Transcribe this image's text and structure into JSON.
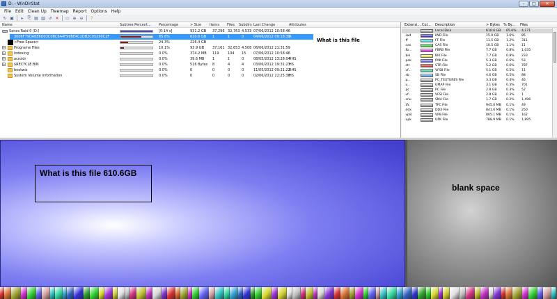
{
  "window": {
    "title": "D: - WinDirStat",
    "min_label": "–",
    "max_label": "□",
    "close_label": "✕"
  },
  "menu": [
    "File",
    "Edit",
    "Clean Up",
    "Treemap",
    "Report",
    "Options",
    "Help"
  ],
  "toolbar_icons": [
    "refresh-icon",
    "select-icon",
    "stop-icon",
    "copy-icon",
    "open-icon",
    "properties-icon",
    "cleanup-icon",
    "delete-icon",
    "new-folder-icon",
    "zoom-in-icon",
    "zoom-out-icon",
    "help-icon"
  ],
  "dir_columns": [
    "Name",
    "Subtree Percent...",
    "Percentage",
    "> Size",
    "Items",
    "Files",
    "Subdirs",
    "Last Change",
    "Attributes"
  ],
  "dir_rows": [
    {
      "expander": "",
      "icon": "drive",
      "name": "Sanes Raid 0 (D:)",
      "bar_pct": 1.0,
      "bar_color": "#4a4aa8",
      "pct": "[0:14 s]",
      "size": "931.2 GB",
      "items": "37,296",
      "files": "32,763",
      "subdirs": "4,533",
      "last_change": "07/06/2012 10:58:46",
      "attr": ""
    },
    {
      "expander": "",
      "icon": "none",
      "name": "3008F79DA6E6D03C0BC6A4F99BE4C2DB2C05290C2F",
      "bar_pct": 0.656,
      "bar_color": "#7a1f1f",
      "pct": "65.6%",
      "size": "610.6 GB",
      "items": "1",
      "files": "1",
      "subdirs": "0",
      "last_change": "04/06/2012 09:18:39",
      "attr": "A",
      "selected": true
    },
    {
      "expander": "",
      "icon": "black",
      "name": "<Free Space>",
      "bar_pct": 0.243,
      "bar_color": "#7a1f1f",
      "pct": "24.3%",
      "size": "226.4 GB",
      "items": "",
      "files": "",
      "subdirs": "",
      "last_change": "",
      "attr": ""
    },
    {
      "expander": "+",
      "icon": "folder",
      "name": "Programe Files",
      "bar_pct": 0.101,
      "bar_color": "#7a1f1f",
      "pct": "10.1%",
      "size": "93.9 GB",
      "items": "37,161",
      "files": "32,653",
      "subdirs": "4,508",
      "last_change": "06/06/2012 21:31:59",
      "attr": ""
    },
    {
      "expander": "+",
      "icon": "folder",
      "name": "indexing",
      "bar_pct": 0.0,
      "bar_color": "#7a1f1f",
      "pct": "0.0%",
      "size": "374.2 MB",
      "items": "119",
      "files": "104",
      "subdirs": "15",
      "last_change": "07/06/2012 10:58:46",
      "attr": ""
    },
    {
      "expander": "+",
      "icon": "folder",
      "name": "acroldr",
      "bar_pct": 0.0,
      "bar_color": "#7a1f1f",
      "pct": "0.0%",
      "size": "39.6 MB",
      "items": "1",
      "files": "1",
      "subdirs": "0",
      "last_change": "08/05/2012 13:28:04",
      "attr": "RHS"
    },
    {
      "expander": "+",
      "icon": "folder",
      "name": "$RECYCLE.BIN",
      "bar_pct": 0.0,
      "bar_color": "#7a1f1f",
      "pct": "0.0%",
      "size": "516 Bytes",
      "items": "8",
      "files": "4",
      "subdirs": "4",
      "last_change": "03/06/2012 19:31:23",
      "attr": "HS"
    },
    {
      "expander": "",
      "icon": "folder",
      "name": "bootwiz",
      "bar_pct": 0.0,
      "bar_color": "#7a1f1f",
      "pct": "0.0%",
      "size": "0",
      "items": "0",
      "files": "0",
      "subdirs": "0",
      "last_change": "11/05/2012 09:21:22",
      "attr": "RHS"
    },
    {
      "expander": "",
      "icon": "folder",
      "name": "System Volume Information",
      "bar_pct": 0.0,
      "bar_color": "#7a1f1f",
      "pct": "0.0%",
      "size": "0",
      "items": "0",
      "files": "0",
      "subdirs": "0",
      "last_change": "02/06/2012 22:25:38",
      "attr": "HS"
    }
  ],
  "annotation_row": "What is this file",
  "ext_columns": [
    "Extensi...",
    "Col...",
    "Description",
    "> Bytes",
    "% By...",
    "Files"
  ],
  "ext_rows": [
    {
      "ext": "",
      "color": "#a0a0a0",
      "desc": "Local Disk",
      "bytes": "610.6 GB",
      "pct": "65.6%",
      "files": "4,171"
    },
    {
      "ext": ".iwd",
      "color": "#3b3bd9",
      "desc": "IWD File",
      "bytes": "15.0 GB",
      "pct": "1.6%",
      "files": "85"
    },
    {
      "ext": ".ff",
      "color": "#3bd9d9",
      "desc": "FF File",
      "bytes": "11.5 GB",
      "pct": "1.2%",
      "files": "311"
    },
    {
      "ext": ".cas",
      "color": "#3bd93b",
      "desc": "CAS File",
      "bytes": "10.5 GB",
      "pct": "1.1%",
      "files": "11"
    },
    {
      "ext": ".fb...",
      "color": "#d93bd9",
      "desc": "FBRB File",
      "bytes": "7.7 GB",
      "pct": "0.8%",
      "files": "1,035"
    },
    {
      "ext": ".bik",
      "color": "#d9d93b",
      "desc": "BIK File",
      "bytes": "7.7 GB",
      "pct": "0.8%",
      "files": "233"
    },
    {
      "ext": ".pak",
      "color": "#6060f0",
      "desc": "PAK File",
      "bytes": "5.3 GB",
      "pct": "0.6%",
      "files": "53"
    },
    {
      "ext": ".str",
      "color": "#d93b3b",
      "desc": "STR File",
      "bytes": "5.2 GB",
      "pct": "0.6%",
      "files": "787"
    },
    {
      "ext": ".vf...",
      "color": "#3bd9a0",
      "desc": "VFS8 File",
      "bytes": "5.1 GB",
      "pct": "0.5%",
      "files": "11"
    },
    {
      "ext": ".sb",
      "color": "#60a0f0",
      "desc": "SB File",
      "bytes": "4.6 GB",
      "pct": "0.5%",
      "files": "88"
    },
    {
      "ext": ".p...",
      "color": "#a0a0a0",
      "desc": "PC_TEXTURES File",
      "bytes": "3.3 GB",
      "pct": "0.4%",
      "files": "46"
    },
    {
      "ext": ".u...",
      "color": "#a0a0a0",
      "desc": "UMAP File",
      "bytes": "3.1 GB",
      "pct": "0.3%",
      "files": "701"
    },
    {
      "ext": ".pc",
      "color": "#a0a0a0",
      "desc": "PC File",
      "bytes": "2.8 GB",
      "pct": "0.3%",
      "files": "52"
    },
    {
      "ext": ".vf...",
      "color": "#a0a0a0",
      "desc": "VFSI File",
      "bytes": "2.8 GB",
      "pct": "0.3%",
      "files": "1"
    },
    {
      "ext": ".snu",
      "color": "#a0a0a0",
      "desc": "SNU File",
      "bytes": "1.7 GB",
      "pct": "0.2%",
      "files": "1,496"
    },
    {
      "ext": ".tfc",
      "color": "#a0a0a0",
      "desc": "TFC File",
      "bytes": "945.6 MB",
      "pct": "0.1%",
      "files": "49"
    },
    {
      "ext": ".ddx",
      "color": "#a0a0a0",
      "desc": "DDX File",
      "bytes": "841.6 MB",
      "pct": "0.1%",
      "files": "250"
    },
    {
      "ext": ".vp8",
      "color": "#a0a0a0",
      "desc": "VP8 File",
      "bytes": "805.1 MB",
      "pct": "0.1%",
      "files": "162"
    },
    {
      "ext": ".upk",
      "color": "#a0a0a0",
      "desc": "UPK File",
      "bytes": "788.9 MB",
      "pct": "0.1%",
      "files": "1,895"
    }
  ],
  "treemap": {
    "blue_label": "What is this file 610.6GB",
    "blank_label": "blank space",
    "strip_colors": [
      "#d83030",
      "#30c0c0",
      "#d8d830",
      "#c030c0",
      "#30d030",
      "#3030d8",
      "#c0c0c0",
      "#d87030",
      "#30d8a0",
      "#a030d8",
      "#d8d8d8",
      "#6060f0",
      "#30a030",
      "#d03080",
      "#a0a030",
      "#30a0d0",
      "#d0d030",
      "#8030d0",
      "#d0a0a0",
      "#30d030",
      "#c0c030",
      "#d030d0",
      "#3060c0",
      "#e0e0e0"
    ]
  }
}
